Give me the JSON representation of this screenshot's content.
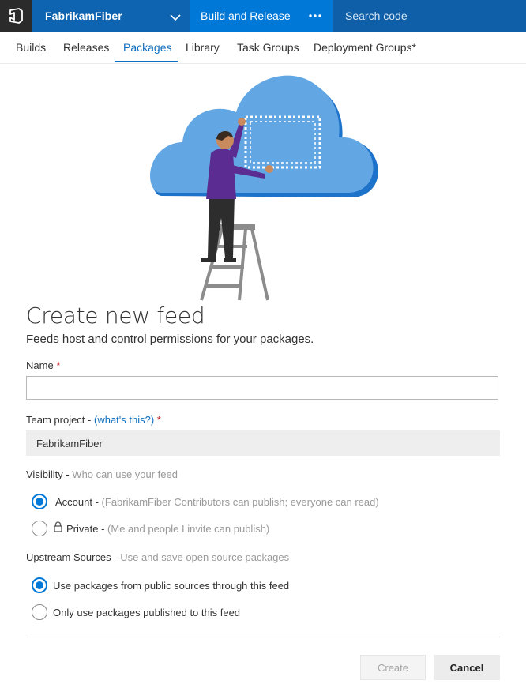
{
  "topbar": {
    "account": "FabrikamFiber",
    "hub": "Build and Release",
    "more_icon": "ellipsis-icon",
    "search_placeholder": "Search code"
  },
  "subnav": {
    "tabs": [
      "Builds",
      "Releases",
      "Packages",
      "Library",
      "Task Groups",
      "Deployment Groups*"
    ],
    "selected": "Packages"
  },
  "form": {
    "title": "Create new feed",
    "subtitle": "Feeds host and control permissions for your packages.",
    "name_label": "Name",
    "required_mark": "*",
    "name_value": "",
    "team_project_label": "Team project -",
    "team_project_link": "(what's this?)",
    "team_project_value": "FabrikamFiber",
    "visibility_label": "Visibility -",
    "visibility_hint": "Who can use your feed",
    "visibility_options": [
      {
        "label": "Account -",
        "hint": "(FabrikamFiber Contributors can publish; everyone can read)",
        "selected": true
      },
      {
        "label": "Private -",
        "hint": "(Me and people I invite can publish)",
        "selected": false
      }
    ],
    "upstream_label": "Upstream Sources -",
    "upstream_hint": "Use and save open source packages",
    "upstream_options": [
      {
        "label": "Use packages from public sources through this feed",
        "selected": true
      },
      {
        "label": "Only use packages published to this feed",
        "selected": false
      }
    ],
    "create_button": "Create",
    "cancel_button": "Cancel"
  },
  "colors": {
    "topbar": "#106ebe",
    "accent": "#0078d7",
    "required": "#c1121f"
  }
}
